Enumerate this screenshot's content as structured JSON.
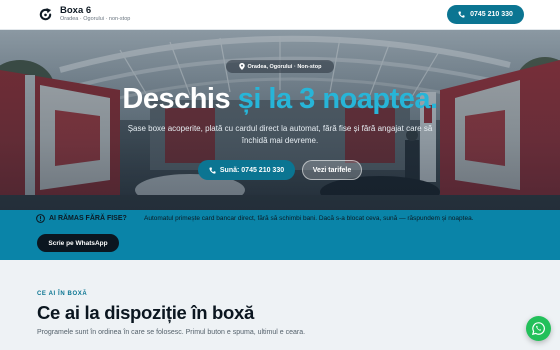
{
  "header": {
    "brand_name": "Boxa 6",
    "brand_sub": "Oradea · Ogorului · non-stop",
    "call_label": "0745 210 330"
  },
  "hero": {
    "location": "Oradea, Ogorului · Non-stop",
    "headline_main": "Deschis",
    "headline_accent": "și la 3 noaptea.",
    "description": "Șase boxe acoperite, plată cu cardul direct la automat, fără fise și fără angajat care să închidă mai devreme.",
    "call_button": "Sună: 0745 210 330",
    "tariffs_button": "Vezi tarifele"
  },
  "banner": {
    "title": "AI RĂMAS FĂRĂ FISE?",
    "text": "Automatul primește card bancar direct, fără să schimbi bani. Dacă s-a blocat ceva, sună — răspundem și noaptea.",
    "whatsapp_button": "Scrie pe WhatsApp"
  },
  "section": {
    "eyebrow": "CE AI ÎN BOXĂ",
    "title": "Ce ai la dispoziție în boxă",
    "description": "Programele sunt în ordinea în care se folosesc. Primul buton e spuma, ultimul e ceara."
  },
  "colors": {
    "primary": "#0b7592",
    "accent": "#27b5d8",
    "banner": "#0a84a8",
    "dark": "#0b1620",
    "whatsapp": "#22c05a"
  },
  "icons": {
    "logo": "refresh-logo-icon",
    "phone": "phone-icon",
    "pin": "location-pin-icon",
    "warning": "warning-icon",
    "whatsapp": "whatsapp-icon"
  }
}
